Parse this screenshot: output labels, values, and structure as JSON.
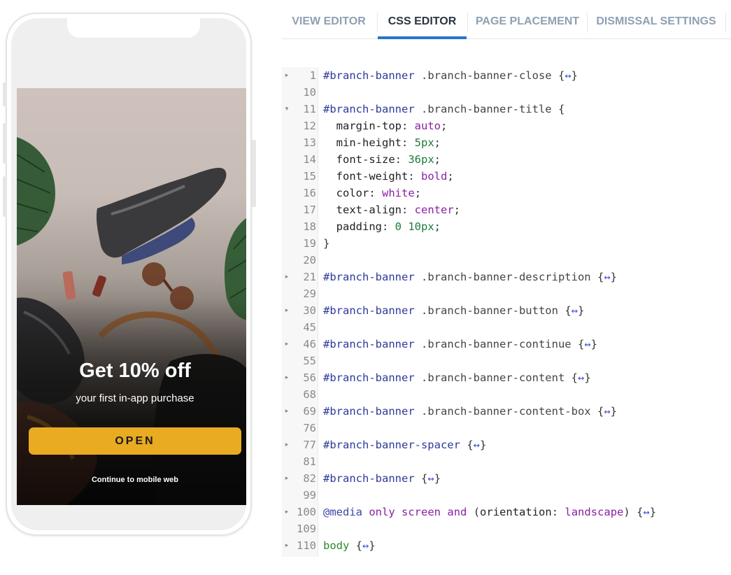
{
  "tabs": [
    {
      "label": "VIEW EDITOR",
      "active": false
    },
    {
      "label": "CSS EDITOR",
      "active": true
    },
    {
      "label": "PAGE PLACEMENT",
      "active": false
    },
    {
      "label": "DISMISSAL SETTINGS",
      "active": false
    }
  ],
  "banner": {
    "title": "Get 10% off",
    "description": "your first in-app purchase",
    "button_label": "OPEN",
    "continue_label": "Continue to mobile web",
    "button_color": "#e8ab22"
  },
  "editor": {
    "fold_marker": "↔",
    "lines": [
      {
        "num": "1",
        "fold": "closed",
        "type": "selector",
        "id": "#branch-banner",
        "cls": ".branch-banner-close",
        "collapsed": true
      },
      {
        "num": "10",
        "fold": "none",
        "type": "blank"
      },
      {
        "num": "11",
        "fold": "open",
        "type": "selector",
        "id": "#branch-banner",
        "cls": ".branch-banner-title",
        "collapsed": false
      },
      {
        "num": "12",
        "fold": "none",
        "type": "decl",
        "prop": "margin-top",
        "value": "auto",
        "vtype": "kw"
      },
      {
        "num": "13",
        "fold": "none",
        "type": "decl",
        "prop": "min-height",
        "value": "5px",
        "vtype": "num"
      },
      {
        "num": "14",
        "fold": "none",
        "type": "decl",
        "prop": "font-size",
        "value": "36px",
        "vtype": "num"
      },
      {
        "num": "15",
        "fold": "none",
        "type": "decl",
        "prop": "font-weight",
        "value": "bold",
        "vtype": "kw"
      },
      {
        "num": "16",
        "fold": "none",
        "type": "decl",
        "prop": "color",
        "value": "white",
        "vtype": "kw"
      },
      {
        "num": "17",
        "fold": "none",
        "type": "decl",
        "prop": "text-align",
        "value": "center",
        "vtype": "kw"
      },
      {
        "num": "18",
        "fold": "none",
        "type": "decl",
        "prop": "padding",
        "value": "0 10px",
        "vtype": "num"
      },
      {
        "num": "19",
        "fold": "none",
        "type": "close"
      },
      {
        "num": "20",
        "fold": "none",
        "type": "blank"
      },
      {
        "num": "21",
        "fold": "closed",
        "type": "selector",
        "id": "#branch-banner",
        "cls": ".branch-banner-description",
        "collapsed": true
      },
      {
        "num": "29",
        "fold": "none",
        "type": "blank"
      },
      {
        "num": "30",
        "fold": "closed",
        "type": "selector",
        "id": "#branch-banner",
        "cls": ".branch-banner-button",
        "collapsed": true
      },
      {
        "num": "45",
        "fold": "none",
        "type": "blank"
      },
      {
        "num": "46",
        "fold": "closed",
        "type": "selector",
        "id": "#branch-banner",
        "cls": ".branch-banner-continue",
        "collapsed": true
      },
      {
        "num": "55",
        "fold": "none",
        "type": "blank"
      },
      {
        "num": "56",
        "fold": "closed",
        "type": "selector",
        "id": "#branch-banner",
        "cls": ".branch-banner-content",
        "collapsed": true
      },
      {
        "num": "68",
        "fold": "none",
        "type": "blank"
      },
      {
        "num": "69",
        "fold": "closed",
        "type": "selector",
        "id": "#branch-banner",
        "cls": ".branch-banner-content-box",
        "collapsed": true
      },
      {
        "num": "76",
        "fold": "none",
        "type": "blank"
      },
      {
        "num": "77",
        "fold": "closed",
        "type": "selector",
        "id": "#branch-banner-spacer",
        "cls": "",
        "collapsed": true
      },
      {
        "num": "81",
        "fold": "none",
        "type": "blank"
      },
      {
        "num": "82",
        "fold": "closed",
        "type": "selector",
        "id": "#branch-banner",
        "cls": "",
        "collapsed": true
      },
      {
        "num": "99",
        "fold": "none",
        "type": "blank"
      },
      {
        "num": "100",
        "fold": "closed",
        "type": "media",
        "at": "@media",
        "words": [
          "only",
          "screen",
          "and"
        ],
        "feature": "orientation",
        "fval": "landscape",
        "collapsed": true
      },
      {
        "num": "109",
        "fold": "none",
        "type": "blank"
      },
      {
        "num": "110",
        "fold": "closed",
        "type": "element",
        "tag": "body",
        "collapsed": true
      }
    ]
  }
}
